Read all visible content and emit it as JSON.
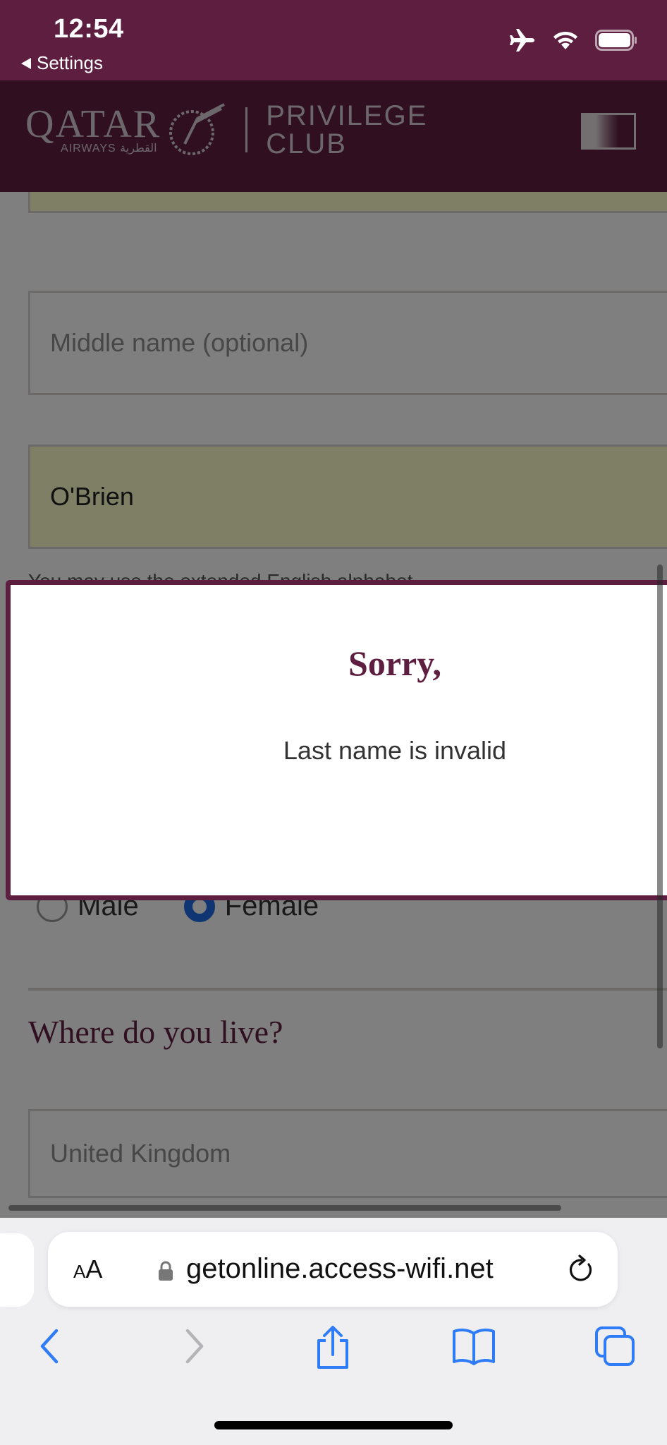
{
  "status_bar": {
    "time": "12:54",
    "back_label": "Settings",
    "icons": [
      "airplane-icon",
      "wifi-icon",
      "battery-icon"
    ]
  },
  "header": {
    "brand": "QATAR",
    "brand_sub": "AIRWAYS القطرية",
    "program_line1": "PRIVILEGE",
    "program_line2": "CLUB",
    "menu_icon": "menu-icon"
  },
  "form": {
    "middle_name_placeholder": "Middle name (optional)",
    "last_name_value": "O'Brien",
    "hint_text": "You may use the extended English alphabet",
    "gender_options": [
      "Male",
      "Female"
    ],
    "gender_selected": "Female",
    "section_title": "Where do you live?",
    "country_value": "United Kingdom"
  },
  "modal": {
    "title": "Sorry,",
    "message": "Last name is invalid"
  },
  "browser": {
    "text_size_label_small": "A",
    "text_size_label_large": "A",
    "url": "getonline.access-wifi.net",
    "toolbar": [
      "back-icon",
      "forward-icon",
      "share-icon",
      "bookmarks-icon",
      "tabs-icon"
    ]
  },
  "colors": {
    "brand": "#5e1e40",
    "autofill": "#fdfec9",
    "ios_blue": "#2f7cf6"
  }
}
